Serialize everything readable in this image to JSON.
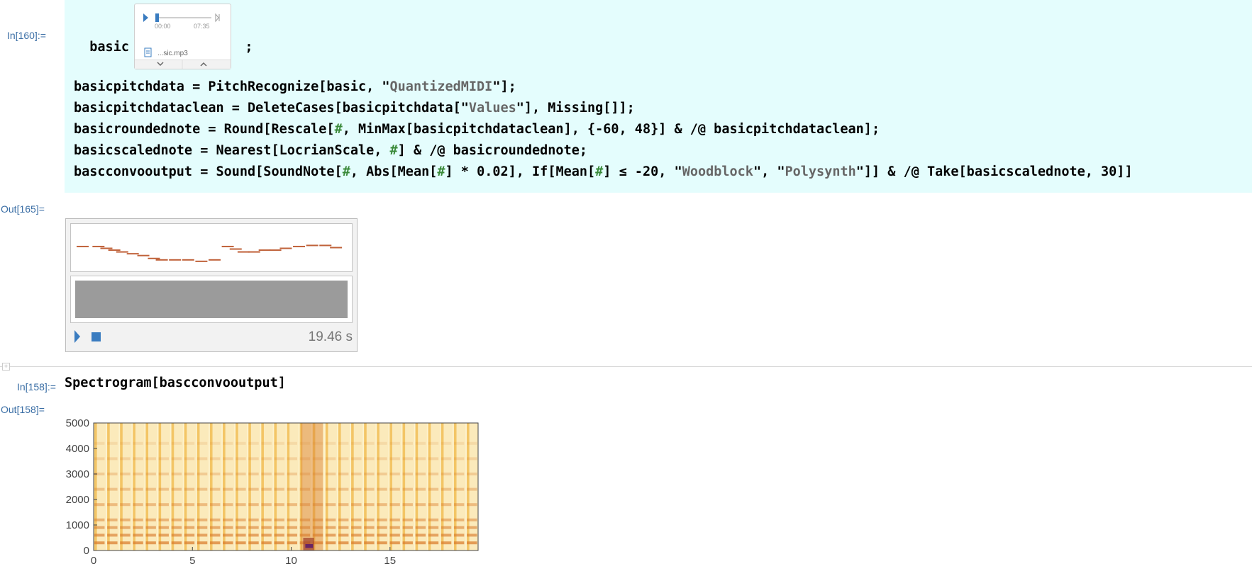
{
  "cells": {
    "in160_label": "In[160]:=",
    "out165_label": "Out[165]=",
    "in158_label": "In[158]:=",
    "out158_label": "Out[158]="
  },
  "code": {
    "l0_prefix": "basic = ",
    "l0_suffix": ";",
    "l1": [
      "basicpitchdata = PitchRecognize[basic, \"",
      "QuantizedMIDI",
      "\"];"
    ],
    "l2": [
      "basicpitchdataclean = DeleteCases[basicpitchdata[\"",
      "Values",
      "\"], Missing[]];"
    ],
    "l3": [
      "basicroundednote = Round[Rescale[",
      "#",
      ", MinMax[basicpitchdataclean], {-60, 48}] & /@ basicpitchdataclean];"
    ],
    "l4": [
      "basicscalednote = Nearest[LocrianScale, ",
      "#",
      "] & /@ basicroundednote;"
    ],
    "l5": [
      "bascconvooutput = Sound[SoundNote[",
      "#",
      ", Abs[Mean[",
      "#",
      "] ",
      "*",
      " 0.02], If[Mean[",
      "#",
      "] ≤ -20, \"",
      "Woodblock",
      "\", \"",
      "Polysynth",
      "\"]] & /@ Take[basicscalednote, 30]]"
    ],
    "spectro": "Spectrogram[bascconvooutput]"
  },
  "audio": {
    "time_start": "00:00",
    "time_end": "07:35",
    "filename": "...sic.mp3",
    "progress": 0.02
  },
  "sound_output": {
    "duration": "19.46 s",
    "notes": [
      {
        "t": 0.0,
        "p": 0.55
      },
      {
        "t": 0.06,
        "p": 0.55
      },
      {
        "t": 0.09,
        "p": 0.5
      },
      {
        "t": 0.12,
        "p": 0.45
      },
      {
        "t": 0.15,
        "p": 0.4
      },
      {
        "t": 0.19,
        "p": 0.35
      },
      {
        "t": 0.23,
        "p": 0.3
      },
      {
        "t": 0.27,
        "p": 0.22
      },
      {
        "t": 0.3,
        "p": 0.18
      },
      {
        "t": 0.35,
        "p": 0.18
      },
      {
        "t": 0.4,
        "p": 0.18
      },
      {
        "t": 0.45,
        "p": 0.14
      },
      {
        "t": 0.5,
        "p": 0.18
      },
      {
        "t": 0.55,
        "p": 0.55
      },
      {
        "t": 0.58,
        "p": 0.48
      },
      {
        "t": 0.61,
        "p": 0.4
      },
      {
        "t": 0.65,
        "p": 0.4
      },
      {
        "t": 0.69,
        "p": 0.45
      },
      {
        "t": 0.73,
        "p": 0.45
      },
      {
        "t": 0.77,
        "p": 0.5
      },
      {
        "t": 0.82,
        "p": 0.55
      },
      {
        "t": 0.87,
        "p": 0.58
      },
      {
        "t": 0.92,
        "p": 0.58
      },
      {
        "t": 0.96,
        "p": 0.52
      }
    ],
    "accent_color": "#3a7cc0",
    "note_color": "#c0623a"
  },
  "chart_data": {
    "type": "heatmap",
    "title": "",
    "xlabel": "",
    "ylabel": "",
    "x_ticks": [
      0,
      5,
      10,
      15
    ],
    "y_ticks": [
      0,
      1000,
      2000,
      3000,
      4000,
      5000
    ],
    "x_tick_labels": [
      "0",
      "5",
      "10",
      "15"
    ],
    "y_tick_labels": [
      "0",
      "1000",
      "2000",
      "3000",
      "4000",
      "5000"
    ],
    "xlim": [
      0,
      19.46
    ],
    "ylim": [
      0,
      5000
    ],
    "onsets": [
      0.0,
      0.65,
      1.3,
      1.95,
      2.6,
      3.25,
      3.9,
      4.55,
      5.2,
      5.85,
      6.5,
      7.15,
      7.8,
      8.45,
      9.1,
      9.75,
      10.4,
      11.05,
      11.7,
      12.35,
      13.0,
      13.65,
      14.3,
      14.95,
      15.6,
      16.25,
      16.9,
      17.55,
      18.2,
      18.85
    ],
    "strong_region": [
      10.5,
      11.6
    ],
    "colors": {
      "background": "#fdf3cf",
      "strip": "#f0b84a",
      "band": "#d87a2a",
      "hot": "#5a1a6a"
    }
  }
}
